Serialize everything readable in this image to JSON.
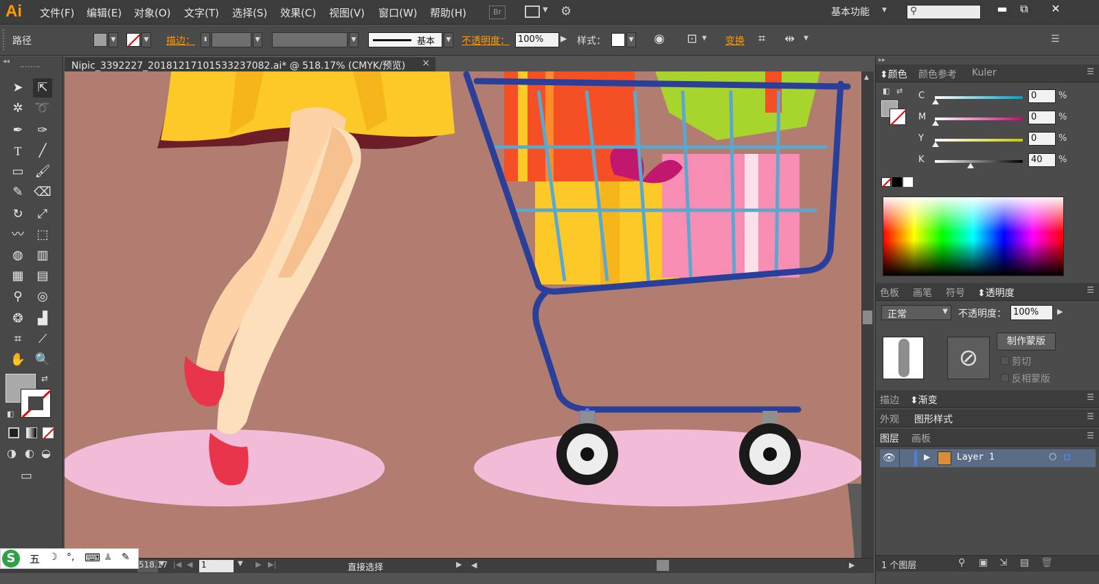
{
  "app": {
    "logo": "Ai"
  },
  "menu": [
    "文件(F)",
    "编辑(E)",
    "对象(O)",
    "文字(T)",
    "选择(S)",
    "效果(C)",
    "视图(V)",
    "窗口(W)",
    "帮助(H)"
  ],
  "workspace": {
    "label": "基本功能",
    "search_placeholder": ""
  },
  "window_buttons": {
    "minimize": "▬",
    "restore": "⧉",
    "close": "✕"
  },
  "controlbar": {
    "object_type": "路径",
    "stroke_label": "描边：",
    "stroke_style": "基本",
    "opacity_label": "不透明度：",
    "opacity_value": "100%",
    "style_label": "样式：",
    "transform_label": "变换"
  },
  "document": {
    "tab_title": "Nipic_3392227_20181217101533237082.ai* @ 518.17% (CMYK/预览)",
    "close": "×"
  },
  "status": {
    "zoom": "518.17",
    "page": "1",
    "tool": "直接选择"
  },
  "color_panel": {
    "tabs": [
      "颜色",
      "颜色参考",
      "Kuler"
    ],
    "channels": [
      {
        "label": "C",
        "value": "0",
        "color": "#00a0c8",
        "level": 0
      },
      {
        "label": "M",
        "value": "0",
        "color": "#d0007a",
        "level": 0
      },
      {
        "label": "Y",
        "value": "0",
        "color": "#c8c800",
        "level": 0
      },
      {
        "label": "K",
        "value": "40",
        "color": "#000000",
        "level": 0.4
      }
    ],
    "pct": "%"
  },
  "transparency_panel": {
    "tabs": [
      "色板",
      "画笔",
      "符号",
      "透明度"
    ],
    "blend_mode": "正常",
    "opacity_label": "不透明度：",
    "opacity_value": "100%",
    "make_mask": "制作蒙版",
    "clip": "剪切",
    "invert_mask": "反相蒙版"
  },
  "stroke_gradient_tabs": [
    "描边",
    "渐变"
  ],
  "appearance_tabs": [
    "外观",
    "图形样式"
  ],
  "layers_panel": {
    "tabs": [
      "图层",
      "画板"
    ],
    "layer_name": "Layer 1",
    "footer": "1 个图层"
  },
  "ime": {
    "items": [
      "五",
      "☽",
      "°,",
      "⌨",
      "♟",
      "✎"
    ]
  },
  "colors": {
    "canvas_bg": "#b07d70",
    "accent": "#ff9900",
    "cart_blue": "#2a3f9a"
  }
}
